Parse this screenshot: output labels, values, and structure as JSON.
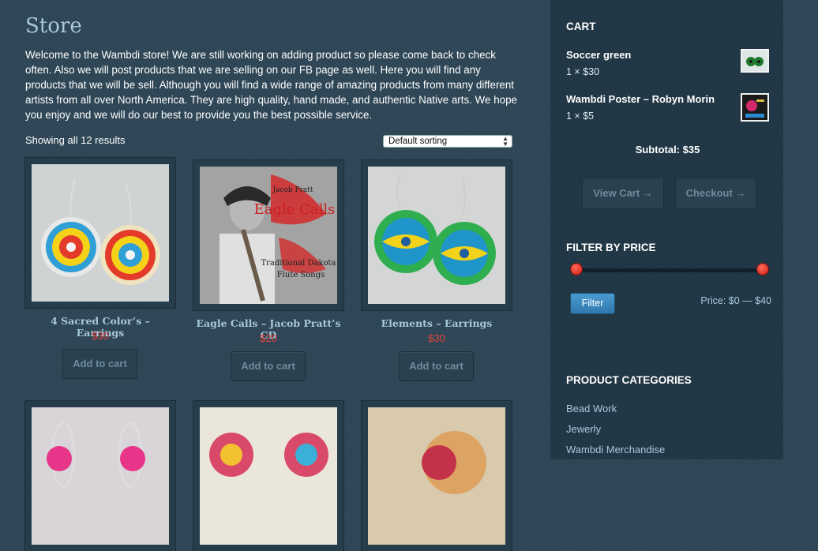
{
  "page": {
    "title": "Store",
    "intro": "Welcome to the Wambdi store! We are still working on adding product so please come back to check often. Also we will post products that we are selling on our FB page as well. Here you will find any products that we will be sell. Although you will find a wide range of amazing products from many different artists from all over North America. They are high quality, hand made, and authentic Native arts. We hope you enjoy and we will do our best to provide you the best possible service."
  },
  "listing": {
    "results": "Showing all 12 results",
    "sort_selected": "Default sorting"
  },
  "products": [
    {
      "title": "4 Sacred Color’s – Earrings",
      "price": "$30",
      "button": "Add to cart"
    },
    {
      "title": "Eagle Calls – Jacob Pratt’s CD",
      "price": "$20",
      "button": "Add to cart",
      "cover_text": "Jacob Pratt / Eagle Calls / Traditional Dakota Flute Songs"
    },
    {
      "title": "Elements – Earrings",
      "price": "$30",
      "button": "Add to cart"
    }
  ],
  "cart": {
    "title": "CART",
    "items": [
      {
        "name": "Soccer green",
        "qty": "1 × $30"
      },
      {
        "name": "Wambdi Poster – Robyn Morin",
        "qty": "1 × $5"
      }
    ],
    "subtotal": "Subtotal: $35",
    "view_cart": "View Cart →",
    "checkout": "Checkout →"
  },
  "filter": {
    "title": "FILTER BY PRICE",
    "button": "Filter",
    "range": "Price: $0 — $40",
    "min_fraction": 0,
    "max_fraction": 1
  },
  "categories": {
    "title": "PRODUCT CATEGORIES",
    "items": [
      "Bead Work",
      "Jewerly",
      "Wambdi Merchandise"
    ]
  },
  "colors": {
    "accent": "#a9c8dd",
    "price": "#e8423b",
    "background": "#2d4555"
  }
}
